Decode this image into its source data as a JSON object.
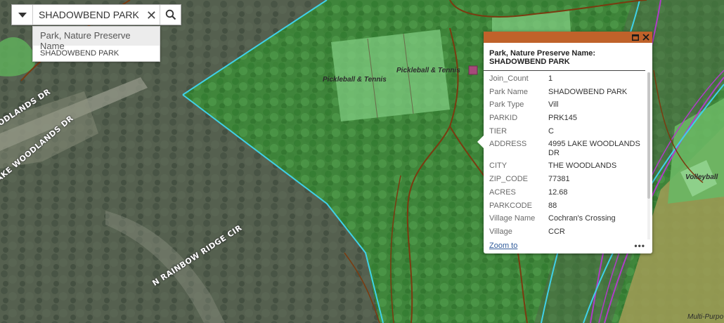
{
  "colors": {
    "imagery_dark": "#4f5a4c",
    "park_green": "#3f8f3a",
    "park_light": "#6fb56c",
    "boundary_cyan": "#3fd0e8",
    "trail_brown": "#7a3b10",
    "road_purple": "#b03cc8",
    "popup_header": "#c0622a",
    "yellow_zone": "#9a9a55"
  },
  "map": {
    "street_labels": {
      "woodlands_top": "ODLANDS DR",
      "woodlands_lake": "AKE WOODLANDS DR",
      "rainbow_ridge": "N RAINBOW RIDGE CIR"
    },
    "poi_labels": {
      "pickleball_1": "Pickleball & Tennis",
      "pickleball_2": "Pickleball & Tennis",
      "volleyball": "Volleyball",
      "multi_purpose": "Multi-Purpo"
    }
  },
  "search": {
    "value": "SHADOWBEND PARK",
    "source_icon": "chevron-down-icon",
    "clear_icon": "close-icon",
    "search_icon": "search-icon",
    "suggestions": {
      "group_label": "Park, Nature Preserve Name",
      "items": [
        "SHADOWBEND PARK"
      ]
    }
  },
  "popup": {
    "title_label": "Park, Nature Preserve Name:",
    "title_value": "SHADOWBEND PARK",
    "fields": [
      {
        "key": "Join_Count",
        "value": "1"
      },
      {
        "key": "Park Name",
        "value": "SHADOWBEND PARK"
      },
      {
        "key": "Park Type",
        "value": "Vill"
      },
      {
        "key": "PARKID",
        "value": "PRK145"
      },
      {
        "key": "TIER",
        "value": "C"
      },
      {
        "key": "ADDRESS",
        "value": "4995 LAKE WOODLANDS DR"
      },
      {
        "key": "CITY",
        "value": "THE WOODLANDS"
      },
      {
        "key": "ZIP_CODE",
        "value": "77381"
      },
      {
        "key": "ACRES",
        "value": "12.68"
      },
      {
        "key": "PARKCODE",
        "value": "88"
      },
      {
        "key": "Village Name",
        "value": "Cochran's Crossing"
      },
      {
        "key": "Village",
        "value": "CCR"
      }
    ],
    "zoom_label": "Zoom to",
    "more_label": "•••"
  }
}
